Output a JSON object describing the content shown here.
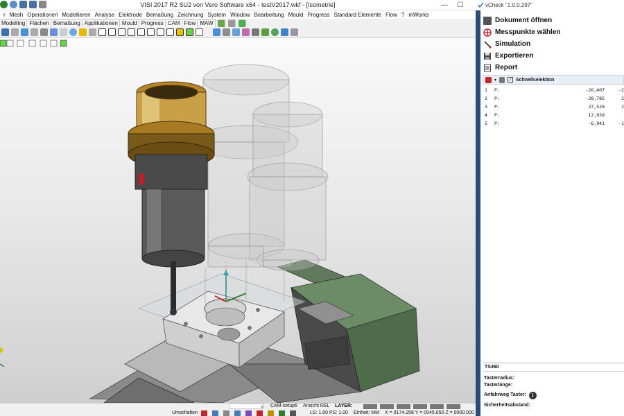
{
  "visi": {
    "window_title": "VISI 2017 R2 SU2 von Vero Software x64 - testV2017.wkf - [Isometrie]",
    "window_controls": {
      "minimize": "—",
      "maximize": "☐",
      "close": "✕"
    },
    "menu": [
      "r",
      "Mesh",
      "Operationen",
      "Modellieren",
      "Analyse",
      "Elektrode",
      "Bemaßung",
      "Zeichnung",
      "System",
      "Window",
      "Bearbeitung",
      "Mould",
      "Progress",
      "Standard Elemente",
      "Flow",
      "?",
      "mWorks"
    ],
    "tabs": [
      "Modelling",
      "Flächen",
      "Bemaßung",
      "Applikationen",
      "Mould",
      "Progress",
      "CAM",
      "Flow",
      "MAW"
    ],
    "active_tab": "CAM",
    "status": {
      "cam_setup": "CAM-setup6",
      "view": "Ansicht REL",
      "layer": "LAYER:",
      "switch": "Umschalten",
      "ls_ps": "LS: 1.00 PS: 1.00",
      "unit": "Einheit: MM",
      "coords": "X = 0174.258 Y = 0045.650 Z = 0000.000"
    }
  },
  "vcheck": {
    "title": "vCheck \"1.0.0.297\"",
    "menu": [
      {
        "label": "Dokument öffnen",
        "icon": "document-icon"
      },
      {
        "label": "Messpunkte wählen",
        "icon": "target-icon"
      },
      {
        "label": "Simulation",
        "icon": "probe-icon"
      },
      {
        "label": "Exportieren",
        "icon": "save-icon"
      },
      {
        "label": "Report",
        "icon": "report-icon"
      }
    ],
    "quick_select_label": "Schnellselektion",
    "points": [
      {
        "n": "1",
        "p": "P:",
        "v1": "-26,407",
        "v2": "-2"
      },
      {
        "n": "2",
        "p": "P:",
        "v1": "-28,785",
        "v2": "2"
      },
      {
        "n": "3",
        "p": "P:",
        "v1": "27,528",
        "v2": "2"
      },
      {
        "n": "4",
        "p": "P:",
        "v1": "12,939",
        "v2": ""
      },
      {
        "n": "5",
        "p": "P:",
        "v1": "-6,941",
        "v2": "-1"
      }
    ],
    "probe_name": "TS460",
    "fields": {
      "tip_radius": "Tasterradius:",
      "tip_length": "Tasterlänge:",
      "approach": "Anfahrweg Taster:",
      "safety": "Sicherheitsabstand:"
    },
    "info_glyph": "i"
  },
  "colors": {
    "panel_border": "#2a4d76",
    "accent_red": "#c0262c"
  }
}
